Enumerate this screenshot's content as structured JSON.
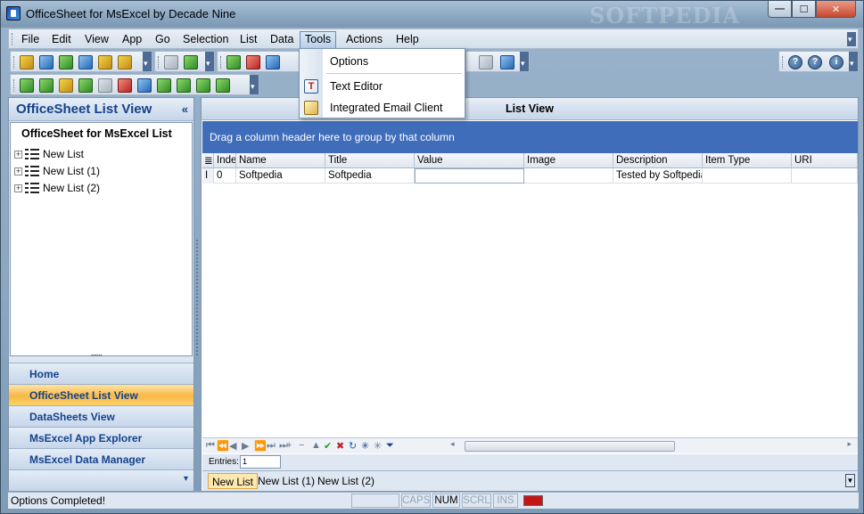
{
  "window": {
    "title": "OfficeSheet for MsExcel by Decade Nine",
    "watermark": "SOFTPEDIA",
    "buttons": {
      "minimize": "—",
      "maximize": "☐",
      "close": "✕"
    }
  },
  "menubar": {
    "items": [
      "File",
      "Edit",
      "View",
      "App",
      "Go",
      "Selection",
      "List",
      "Data",
      "Tools",
      "Actions",
      "Help"
    ],
    "active": "Tools"
  },
  "tools_menu": {
    "items": [
      {
        "label": "Options",
        "icon": "none"
      },
      {
        "label": "Text Editor",
        "icon": "text-editor-icon"
      },
      {
        "label": "Integrated Email Client",
        "icon": "email-client-icon"
      }
    ]
  },
  "toolbar": {
    "help_icons": [
      "?",
      "?",
      "i"
    ]
  },
  "left_panel": {
    "title": "OfficeSheet List View",
    "collapse_glyph": "«",
    "tree_root": "OfficeSheet for MsExcel List",
    "tree_items": [
      "New List",
      "New List (1)",
      "New List (2)"
    ],
    "nav_buttons": [
      {
        "label": "Home",
        "active": false
      },
      {
        "label": "OfficeSheet List View",
        "active": true
      },
      {
        "label": "DataSheets View",
        "active": false
      },
      {
        "label": "MsExcel App Explorer",
        "active": false
      },
      {
        "label": "MsExcel Data Manager",
        "active": false
      }
    ]
  },
  "main_panel": {
    "title": "List View",
    "group_prompt": "Drag a column header here to group by that column",
    "columns": [
      "Inde",
      "Name",
      "Title",
      "Value",
      "Image",
      "Description",
      "Item Type",
      "URI"
    ],
    "rows": [
      [
        "0",
        "Softpedia",
        "Softpedia",
        "",
        "",
        "Tested by Softpedia",
        "",
        ""
      ]
    ],
    "row_marker": "I",
    "entries_label": "Entries:",
    "entries_value": "1",
    "sheet_tabs": [
      {
        "label": "New List",
        "active": true
      },
      {
        "label": "New List (1)",
        "active": false
      },
      {
        "label": "New List (2)",
        "active": false
      }
    ]
  },
  "statusbar": {
    "message": "Options Completed!",
    "indicators": [
      {
        "label": "CAPS",
        "on": false
      },
      {
        "label": "NUM",
        "on": true
      },
      {
        "label": "SCRL",
        "on": false
      },
      {
        "label": "INS",
        "on": false
      }
    ]
  },
  "colors": {
    "group_band": "#3f6dba",
    "active_nav": "#f8b846",
    "header_text": "#15428b"
  }
}
